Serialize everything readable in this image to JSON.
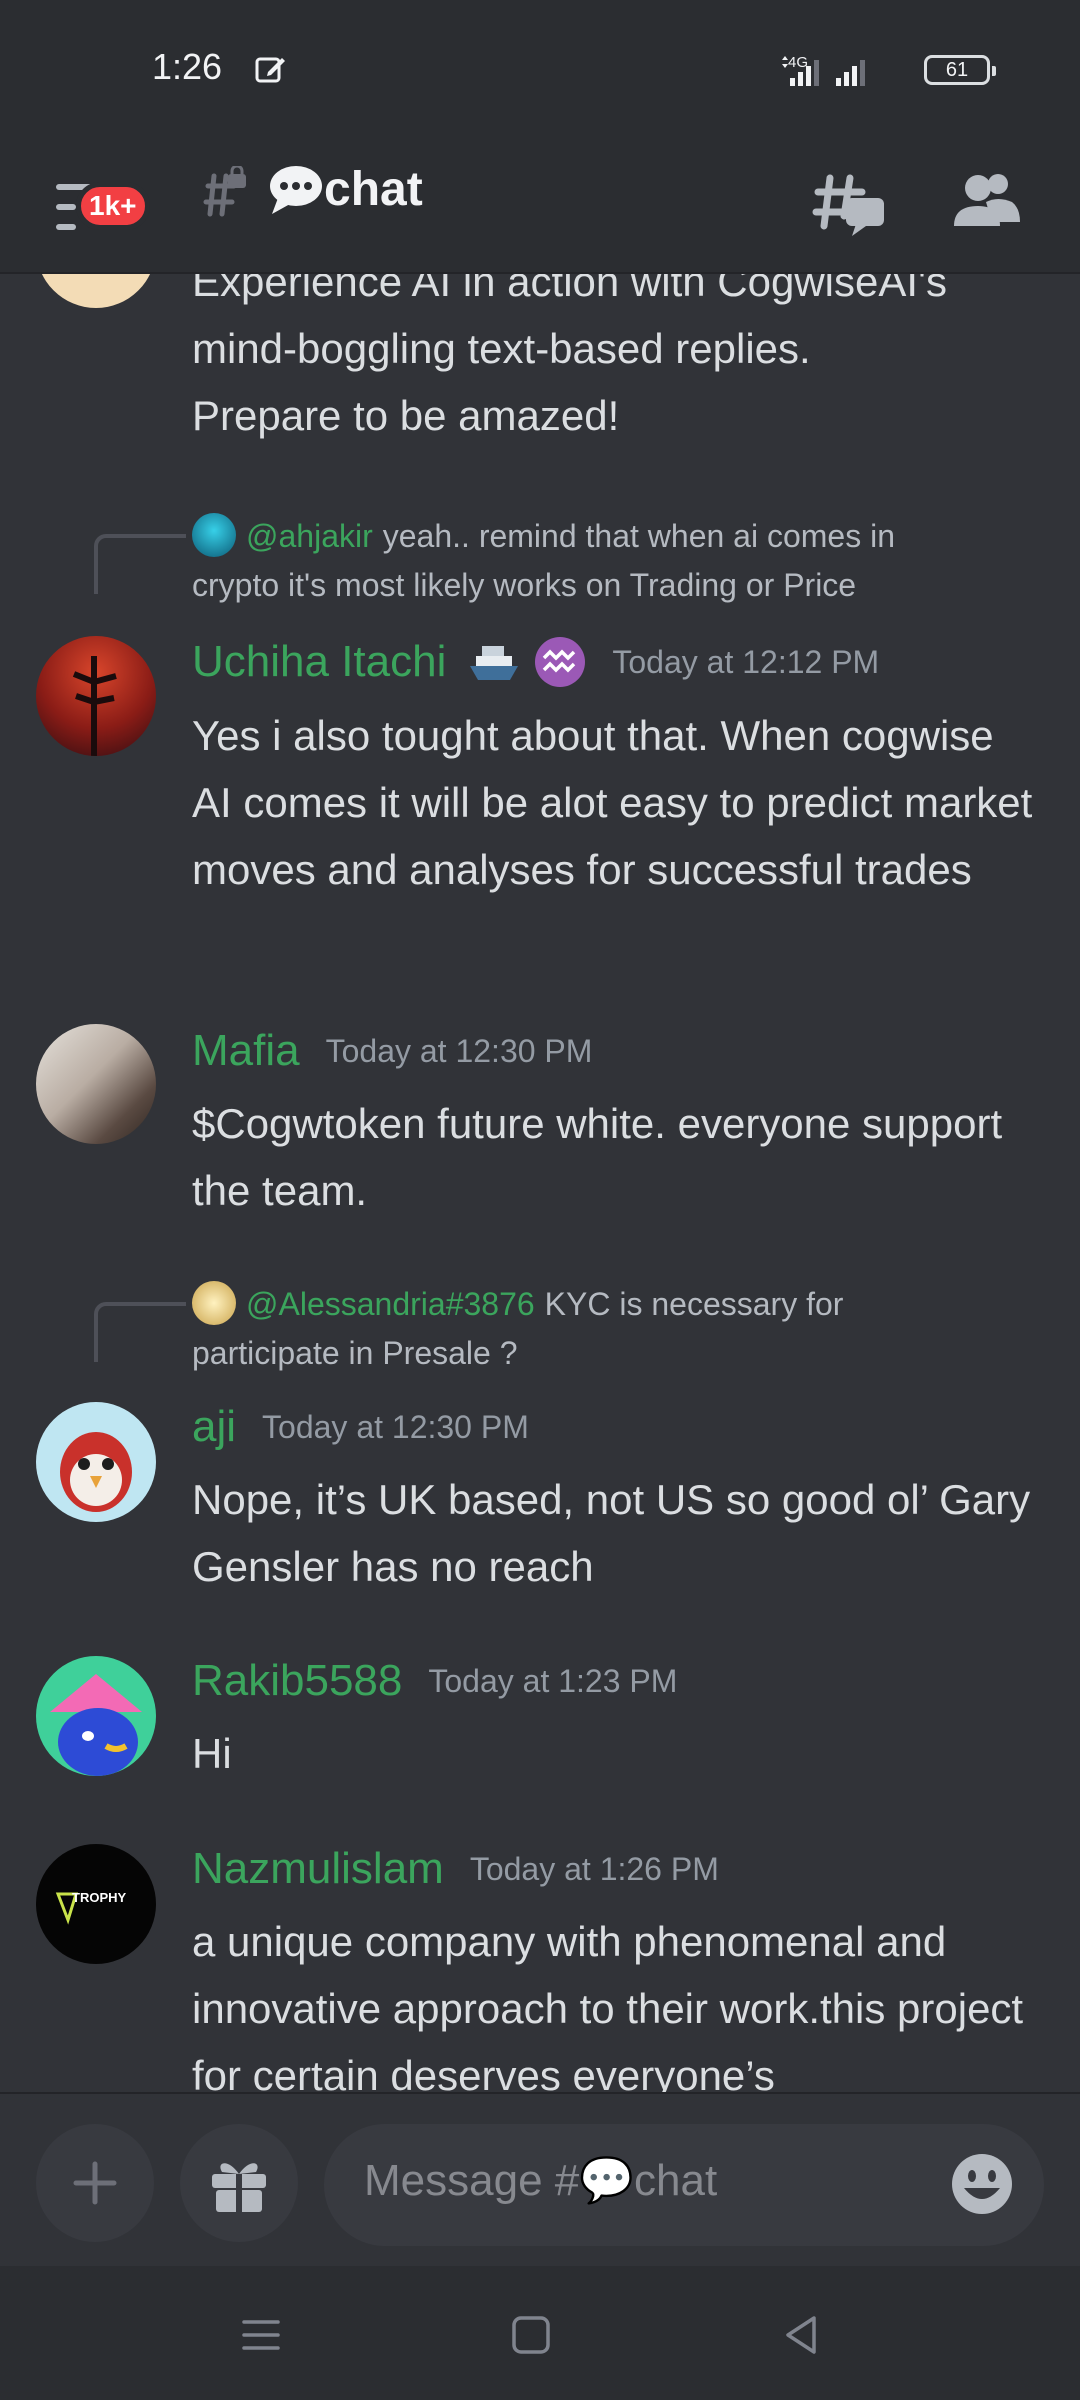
{
  "status_bar": {
    "time": "1:26",
    "network": "4G",
    "battery": "61"
  },
  "header": {
    "notification_badge": "1k+",
    "channel_name": "chat"
  },
  "messages": {
    "partial": {
      "lines": [
        "Experience AI in action with CogwiseAI's",
        "mind-boggling text-based replies.",
        "Prepare to be amazed!"
      ]
    },
    "m1": {
      "reply_mention": "@ahjakir",
      "reply_text": "yeah.. remind that when ai comes in crypto it's most likely works on Trading or Price",
      "username": "Uchiha Itachi",
      "timestamp": "Today at 12:12 PM",
      "text": "Yes i also tought about that. When cogwise AI comes it will be alot easy to predict market moves and analyses for successful trades"
    },
    "m2": {
      "username": "Mafia",
      "timestamp": "Today at 12:30 PM",
      "text": "$Cogwtoken future white. everyone support the team."
    },
    "m3": {
      "reply_mention": "@Alessandria#3876",
      "reply_text": "KYC is necessary for participate in Presale ?",
      "username": "aji",
      "timestamp": "Today at 12:30 PM",
      "text": "Nope, it’s UK based, not US so good ol’ Gary Gensler has no reach"
    },
    "m4": {
      "username": "Rakib5588",
      "timestamp": "Today at 1:23 PM",
      "text": "Hi"
    },
    "m5": {
      "username": "Nazmulislam",
      "timestamp": "Today at 1:26 PM",
      "text": "a unique company with phenomenal and innovative approach to their work.this project for certain deserves everyone’s",
      "avatar_text": "TROPHY"
    }
  },
  "composer": {
    "placeholder": "Message #💬chat"
  },
  "colors": {
    "background": "#313338",
    "header": "#2b2d31",
    "username": "#3ba55d",
    "timestamp": "#949ba4",
    "badge": "#f23f43"
  },
  "icons": [
    "edit-icon",
    "signal-icon",
    "menu-icon",
    "locked-channel-icon",
    "speech-bubble-icon",
    "threads-icon",
    "members-icon",
    "plus-icon",
    "gift-icon",
    "emoji-icon",
    "recent-apps-icon",
    "home-icon",
    "back-icon"
  ]
}
